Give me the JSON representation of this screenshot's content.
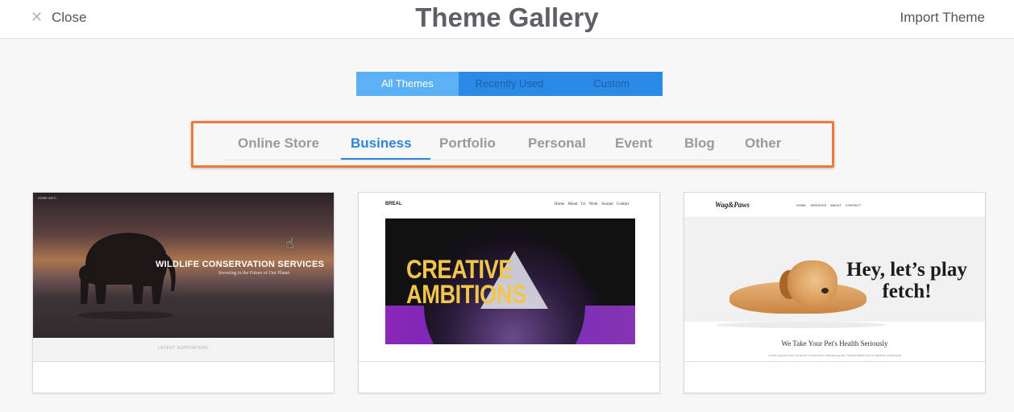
{
  "header": {
    "close_icon": "close-x-icon",
    "close_label": "Close",
    "title": "Theme Gallery",
    "import_label": "Import Theme"
  },
  "segmented": {
    "tabs": [
      {
        "label": "All Themes",
        "active": true
      },
      {
        "label": "Recently Used",
        "active": false
      },
      {
        "label": "Custom",
        "active": false
      }
    ]
  },
  "categories": {
    "items": [
      "Online Store",
      "Business",
      "Portfolio",
      "Personal",
      "Event",
      "Blog",
      "Other"
    ],
    "selected": "Business",
    "highlight_color": "#ee7a3a",
    "accent_color": "#2e86d6"
  },
  "themes": [
    {
      "nav_left": "HOME",
      "nav_right": "INFO",
      "headline": "WILDLIFE CONSERVATION SERVICES",
      "subline": "Investing in the Future of Our Planet",
      "footer_text": "LATEST SUPPORTERS"
    },
    {
      "logo": "BREAL",
      "nav": "Home About Us Work Journal Contact",
      "hero_text_1": "CREATIVE",
      "hero_text_2": "AMBITIONS"
    },
    {
      "logo": "Wag&Paws",
      "nav": "HOME SERVICES ABOUT CONTACT",
      "headline": "Hey, let’s play fetch!",
      "tagline": "We Take Your Pet's Health Seriously",
      "lorem": "Lorem ipsum dolor sit amet consectetur adipiscing elit. Suspendisse luctus facilisis consequat"
    }
  ],
  "cursor_icon": "hand-pointer-icon"
}
